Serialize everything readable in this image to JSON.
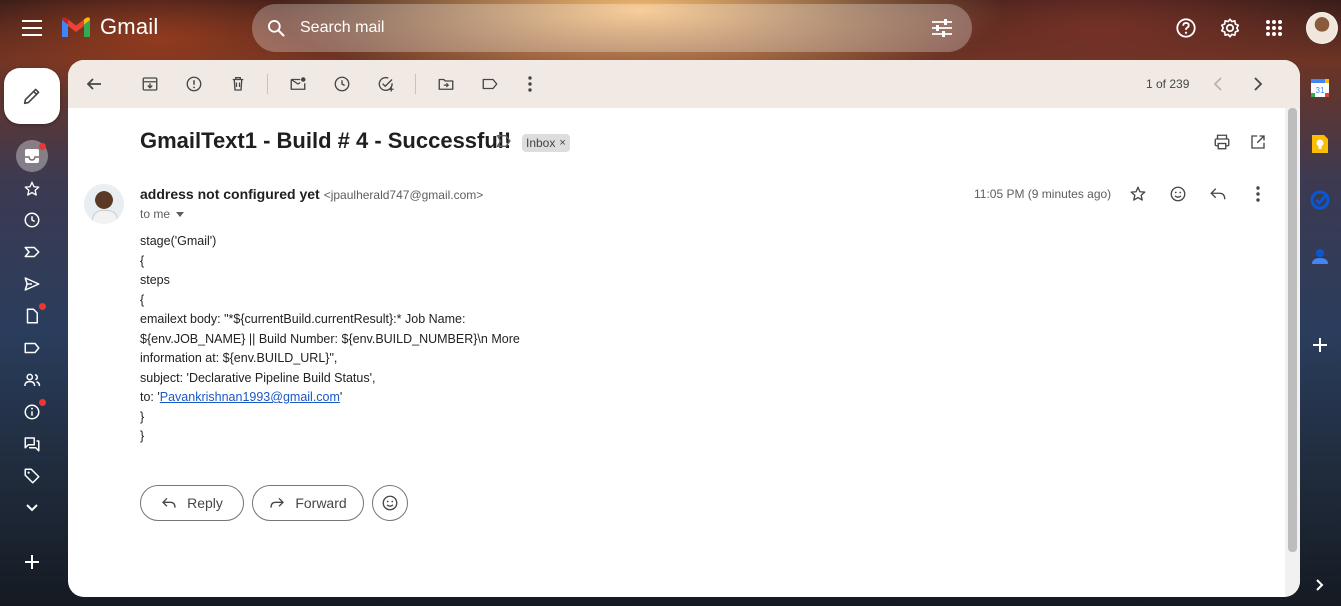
{
  "app": {
    "name": "Gmail"
  },
  "search": {
    "placeholder": "Search mail"
  },
  "toolbar": {
    "pager": "1 of 239"
  },
  "email": {
    "subject": "GmailText1 - Build # 4 - Successful!",
    "label": "Inbox",
    "label_close": "×",
    "sender_name": "address not configured yet",
    "sender_email": "<jpaulherald747@gmail.com>",
    "recipient": "to me",
    "timestamp": "11:05 PM (9 minutes ago)",
    "body_lines": [
      "stage('Gmail')",
      "{",
      "steps",
      "{",
      "emailext body: \"*${currentBuild.currentResult}:* Job Name:",
      "${env.JOB_NAME} || Build Number: ${env.BUILD_NUMBER}\\n More",
      "information at: ${env.BUILD_URL}\",",
      "subject: 'Declarative Pipeline Build Status',",
      "to: '",
      "}",
      "}"
    ],
    "to_link": "Pavankrishnan1993@gmail.com",
    "to_suffix": "'"
  },
  "actions": {
    "reply": "Reply",
    "forward": "Forward"
  },
  "colors": {
    "accent": "#0b57d0",
    "link": "#1a57c7",
    "toolbar_bg": "#f1e9e4"
  }
}
